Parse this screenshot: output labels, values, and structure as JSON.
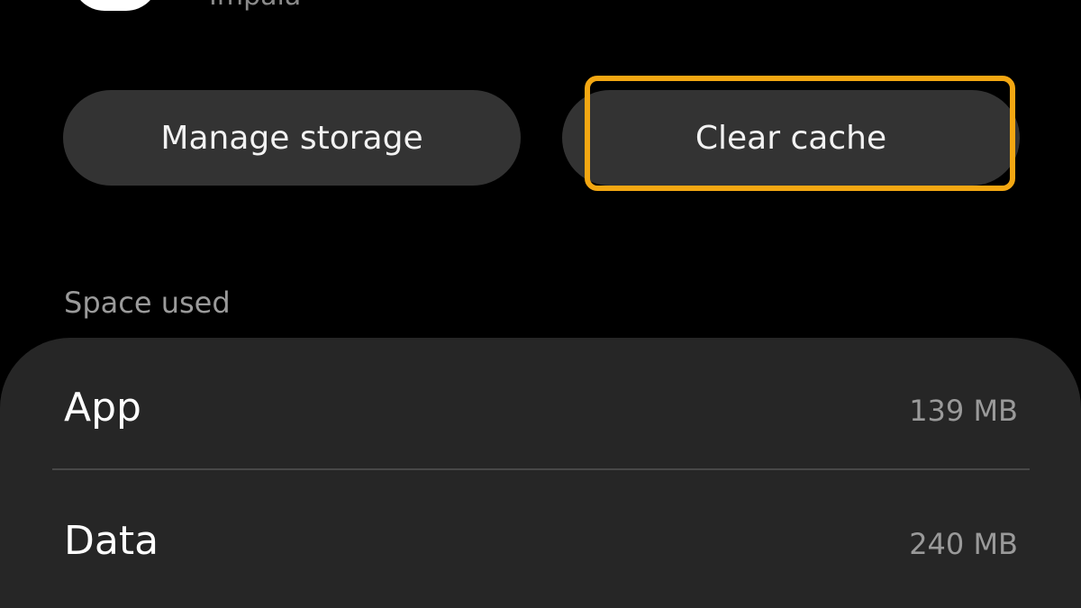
{
  "header": {
    "app_name": "Impala"
  },
  "actions": {
    "manage_storage_label": "Manage storage",
    "clear_cache_label": "Clear cache",
    "highlight_color": "#f3a712"
  },
  "space_used": {
    "section_label": "Space used",
    "rows": [
      {
        "label": "App",
        "value": "139 MB"
      },
      {
        "label": "Data",
        "value": "240 MB"
      }
    ]
  }
}
